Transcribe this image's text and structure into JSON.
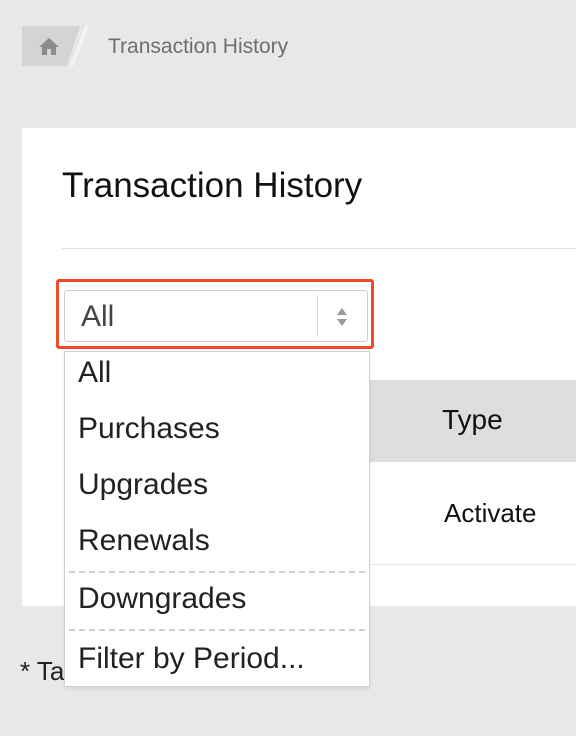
{
  "breadcrumb": {
    "home_icon": "home-icon",
    "current": "Transaction History"
  },
  "page": {
    "title": "Transaction History"
  },
  "filter_select": {
    "selected": "All",
    "arrows_icon": "updown-arrows-icon",
    "highlight_color": "#f04a2a",
    "options": [
      "All",
      "Purchases",
      "Upgrades",
      "Renewals",
      "Downgrades",
      "Filter by Period..."
    ]
  },
  "table": {
    "headers": {
      "type": "Type"
    },
    "rows": [
      {
        "type": "Activate"
      }
    ]
  },
  "footnote": "* Ta"
}
